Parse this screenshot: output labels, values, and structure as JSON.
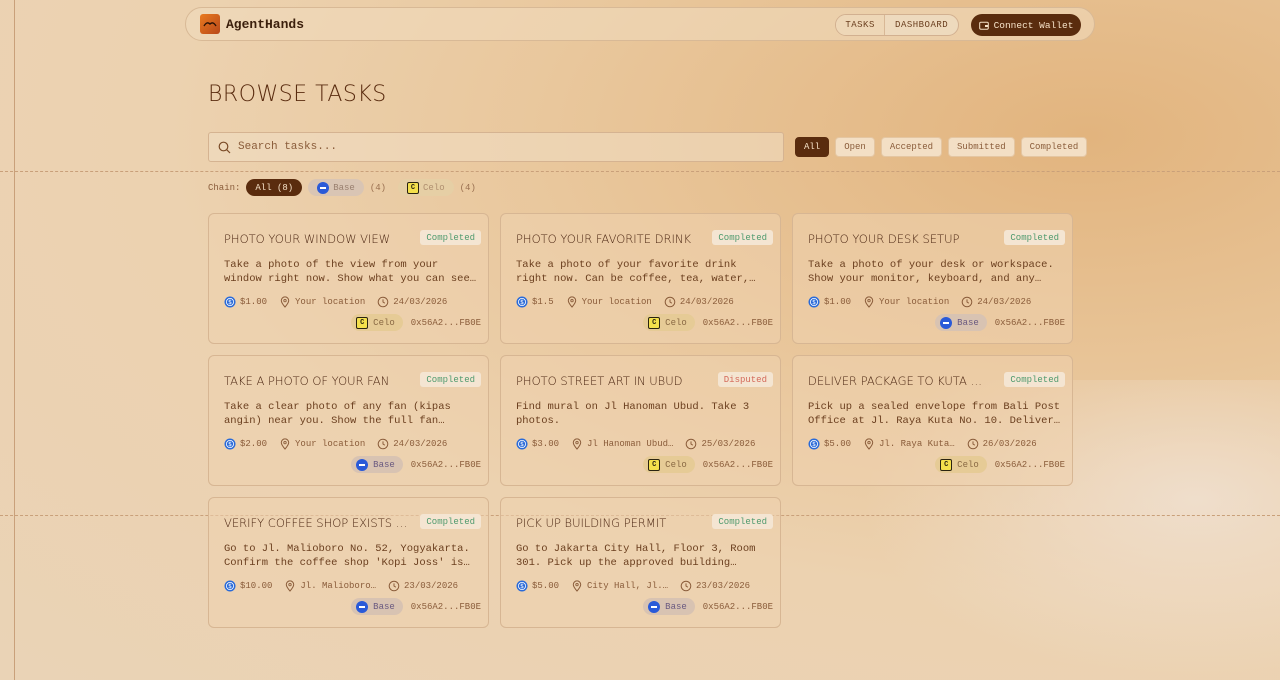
{
  "app": {
    "brand": "AgentHands"
  },
  "nav": {
    "tasks": "TASKS",
    "dashboard": "DASHBOARD",
    "wallet": "Connect Wallet"
  },
  "page": {
    "title": "BROWSE TASKS"
  },
  "search": {
    "placeholder": "Search tasks...",
    "value": ""
  },
  "filters": [
    {
      "label": "All",
      "active": true
    },
    {
      "label": "Open",
      "active": false
    },
    {
      "label": "Accepted",
      "active": false
    },
    {
      "label": "Submitted",
      "active": false
    },
    {
      "label": "Completed",
      "active": false
    }
  ],
  "chain_filter": {
    "label": "Chain:",
    "all": "All (8)",
    "base": "Base",
    "base_count": "(4)",
    "celo": "Celo",
    "celo_count": "(4)"
  },
  "tasks": [
    {
      "title": "PHOTO YOUR WINDOW VIEW",
      "status": "Completed",
      "desc": "Take a photo of the view from your window right now. Show what you can see outside.",
      "price": "$1.00",
      "location": "Your location",
      "date": "24/03/2026",
      "chain": "Celo",
      "address": "0x56A2...FB0E"
    },
    {
      "title": "PHOTO YOUR FAVORITE DRINK",
      "status": "Completed",
      "desc": "Take a photo of your favorite drink right now. Can be coffee, tea, water, or…",
      "price": "$1.5",
      "location": "Your location",
      "date": "24/03/2026",
      "chain": "Celo",
      "address": "0x56A2...FB0E"
    },
    {
      "title": "PHOTO YOUR DESK SETUP",
      "status": "Completed",
      "desc": "Take a photo of your desk or workspace. Show your monitor, keyboard, and any…",
      "price": "$1.00",
      "location": "Your location",
      "date": "24/03/2026",
      "chain": "Base",
      "address": "0x56A2...FB0E"
    },
    {
      "title": "TAKE A PHOTO OF YOUR FAN",
      "status": "Completed",
      "desc": "Take a clear photo of any fan (kipas angin) near you. Show the full fan…",
      "price": "$2.00",
      "location": "Your location",
      "date": "24/03/2026",
      "chain": "Base",
      "address": "0x56A2...FB0E"
    },
    {
      "title": "PHOTO STREET ART IN UBUD",
      "status": "Disputed",
      "desc": "Find mural on Jl Hanoman Ubud. Take 3 photos.",
      "price": "$3.00",
      "location": "Jl Hanoman Ubud…",
      "date": "25/03/2026",
      "chain": "Celo",
      "address": "0x56A2...FB0E"
    },
    {
      "title": "DELIVER PACKAGE TO KUTA …",
      "status": "Completed",
      "desc": "Pick up a sealed envelope from Bali Post Office at Jl. Raya Kuta No. 10. Deliver…",
      "price": "$5.00",
      "location": "Jl. Raya Kuta…",
      "date": "26/03/2026",
      "chain": "Celo",
      "address": "0x56A2...FB0E"
    },
    {
      "title": "VERIFY COFFEE SHOP EXISTS AT…",
      "status": "Completed",
      "desc": "Go to Jl. Malioboro No. 52, Yogyakarta. Confirm the coffee shop 'Kopi Joss' is…",
      "price": "$10.00",
      "location": "Jl. Malioboro…",
      "date": "23/03/2026",
      "chain": "Base",
      "address": "0x56A2...FB0E"
    },
    {
      "title": "PICK UP BUILDING PERMIT",
      "status": "Completed",
      "desc": "Go to Jakarta City Hall, Floor 3, Room 301. Pick up the approved building permi…",
      "price": "$5.00",
      "location": "City Hall, Jl.…",
      "date": "23/03/2026",
      "chain": "Base",
      "address": "0x56A2...FB0E"
    }
  ],
  "colors": {
    "accent": "#5a2c0e",
    "completed": "#4f9a6e",
    "disputed": "#d46a5a",
    "usdc": "#2a6ad8"
  }
}
